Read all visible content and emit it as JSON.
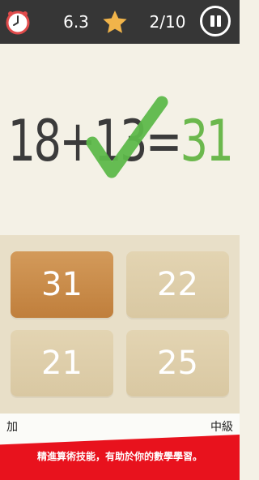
{
  "header": {
    "timer": "6.3",
    "progress": "2/10",
    "icons": {
      "clock": "clock-icon",
      "star": "star-icon",
      "pause": "pause-icon"
    },
    "colors": {
      "background": "#363636",
      "star": "#f1b44a",
      "clock_rim": "#e04b4b"
    }
  },
  "equation": {
    "left": "18+13=",
    "answer": "31",
    "result_icon": "checkmark-icon",
    "colors": {
      "text": "#3b3b3b",
      "answer": "#6bb84d",
      "check": "#5db84a"
    }
  },
  "answers": {
    "options": [
      "31",
      "22",
      "21",
      "25"
    ],
    "selected": "31",
    "colors": {
      "option": "#e3d4b2",
      "selected": "#c98d4b"
    }
  },
  "footer": {
    "operation": "加",
    "level": "中級",
    "banner_text": "精進算術技能，有助於你的數學學習。",
    "banner_color": "#e8121d"
  }
}
